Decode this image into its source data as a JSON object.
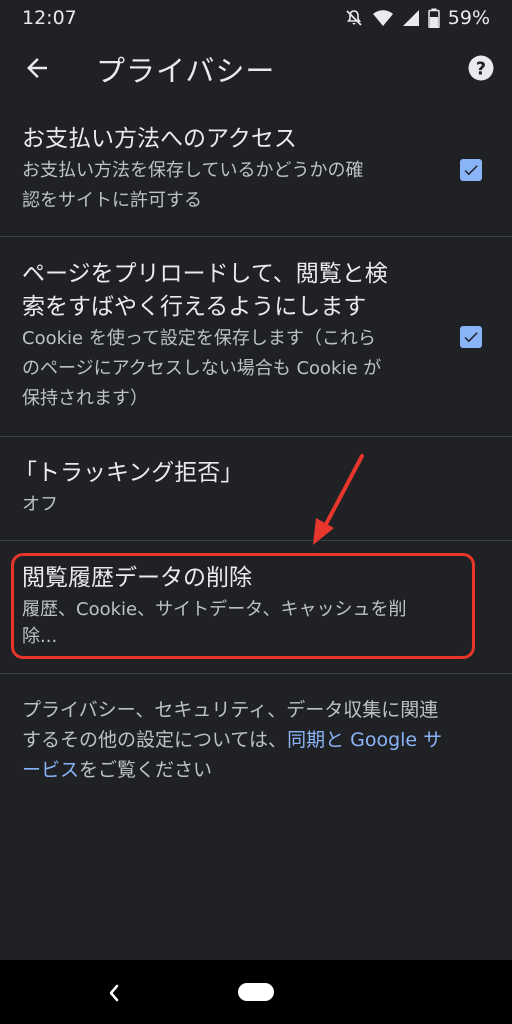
{
  "status_bar": {
    "time": "12:07",
    "battery": "59%"
  },
  "app_bar": {
    "title": "プライバシー"
  },
  "items": [
    {
      "title": "お支払い方法へのアクセス",
      "subtitle_lines": [
        "お支払い方法を保存しているかどうかの確",
        "認をサイトに許可する"
      ],
      "checked": true
    },
    {
      "title_lines": [
        "ページをプリロードして、閲覧と検",
        "索をすばやく行えるようにします"
      ],
      "subtitle_lines": [
        "Cookie を使って設定を保存します（これら",
        "のページにアクセスしない場合も Cookie が",
        "保持されます）"
      ],
      "checked": true
    },
    {
      "title": "「トラッキング拒否」",
      "subtitle": "オフ"
    },
    {
      "title": "閲覧履歴データの削除",
      "subtitle_lines": [
        "履歴、Cookie、サイトデータ、キャッシュを削",
        "除..."
      ]
    }
  ],
  "footer": {
    "line1": "プライバシー、セキュリティ、データ収集に関連",
    "line2_prefix": "するその他の設定については、",
    "link_part1": "同期と Google サ",
    "link_part2": "ービス",
    "line3_suffix": "をご覧ください"
  },
  "colors": {
    "background": "#202124",
    "accent": "#8ab4f8",
    "highlight": "#e8362c"
  },
  "icons": [
    "silent-icon",
    "wifi-icon",
    "signal-icon",
    "battery-icon",
    "back-arrow-icon",
    "help-icon",
    "check-icon",
    "annotation-arrow-icon",
    "nav-back-icon"
  ]
}
